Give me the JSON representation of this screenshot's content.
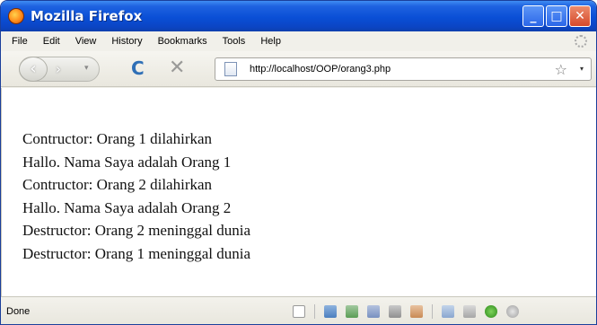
{
  "window": {
    "title": "Mozilla Firefox",
    "controls": {
      "minimize": "_",
      "maximize": "□",
      "close": "✕"
    }
  },
  "menu": {
    "items": [
      "File",
      "Edit",
      "View",
      "History",
      "Bookmarks",
      "Tools",
      "Help"
    ]
  },
  "toolbar": {
    "back_icon": "‹",
    "forward_icon": "›",
    "history_dropdown_icon": "▾",
    "reload_icon": "C",
    "stop_icon": "✕",
    "url": "http://localhost/OOP/orang3.php",
    "bookmark_star_icon": "☆",
    "url_dropdown_icon": "▾"
  },
  "page": {
    "lines": [
      "Contructor: Orang 1 dilahirkan",
      "Hallo. Nama Saya adalah Orang 1",
      "Contructor: Orang 2 dilahirkan",
      "Hallo. Nama Saya adalah Orang 2",
      "Destructor: Orang 2 meninggal dunia",
      "Destructor: Orang 1 meninggal dunia"
    ]
  },
  "status": {
    "text": "Done"
  },
  "colors": {
    "titlebar": "#0a4fd6",
    "reload": "#2f6fb6",
    "close_button": "#d6492b"
  }
}
